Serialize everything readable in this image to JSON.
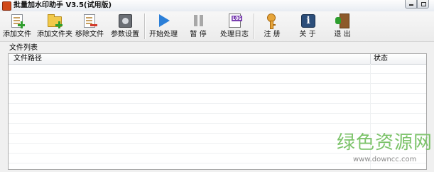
{
  "window": {
    "title": "批量加水印助手 V3.5(试用版)",
    "app_icon": "watermark-app-icon",
    "controls": [
      "minimize",
      "maximize"
    ]
  },
  "toolbar": {
    "add_file": {
      "label": "添加文件",
      "icon": "add-file-icon"
    },
    "add_folder": {
      "label": "添加文件夹",
      "icon": "add-folder-icon"
    },
    "remove_file": {
      "label": "移除文件",
      "icon": "remove-file-icon"
    },
    "settings": {
      "label": "参数设置",
      "icon": "settings-icon"
    },
    "start": {
      "label": "开始处理",
      "icon": "play-icon"
    },
    "pause": {
      "label": "暂 停",
      "icon": "pause-icon"
    },
    "log": {
      "label": "处理日志",
      "icon": "log-icon",
      "badge": "LOG"
    },
    "register": {
      "label": "注 册",
      "icon": "key-icon"
    },
    "about": {
      "label": "关 于",
      "icon": "info-icon",
      "glyph": "i"
    },
    "exit": {
      "label": "退 出",
      "icon": "exit-icon"
    }
  },
  "file_list": {
    "group_label": "文件列表",
    "columns": {
      "path": "文件路径",
      "status": "状态"
    },
    "rows": []
  },
  "watermark": {
    "title": "绿色资源网",
    "url": "www.downcc.com"
  },
  "colors": {
    "accent_play": "#2b7fd8",
    "watermark_green": "#7cc36a",
    "add_green": "#2e9e2e",
    "remove_red": "#d23a2a"
  }
}
